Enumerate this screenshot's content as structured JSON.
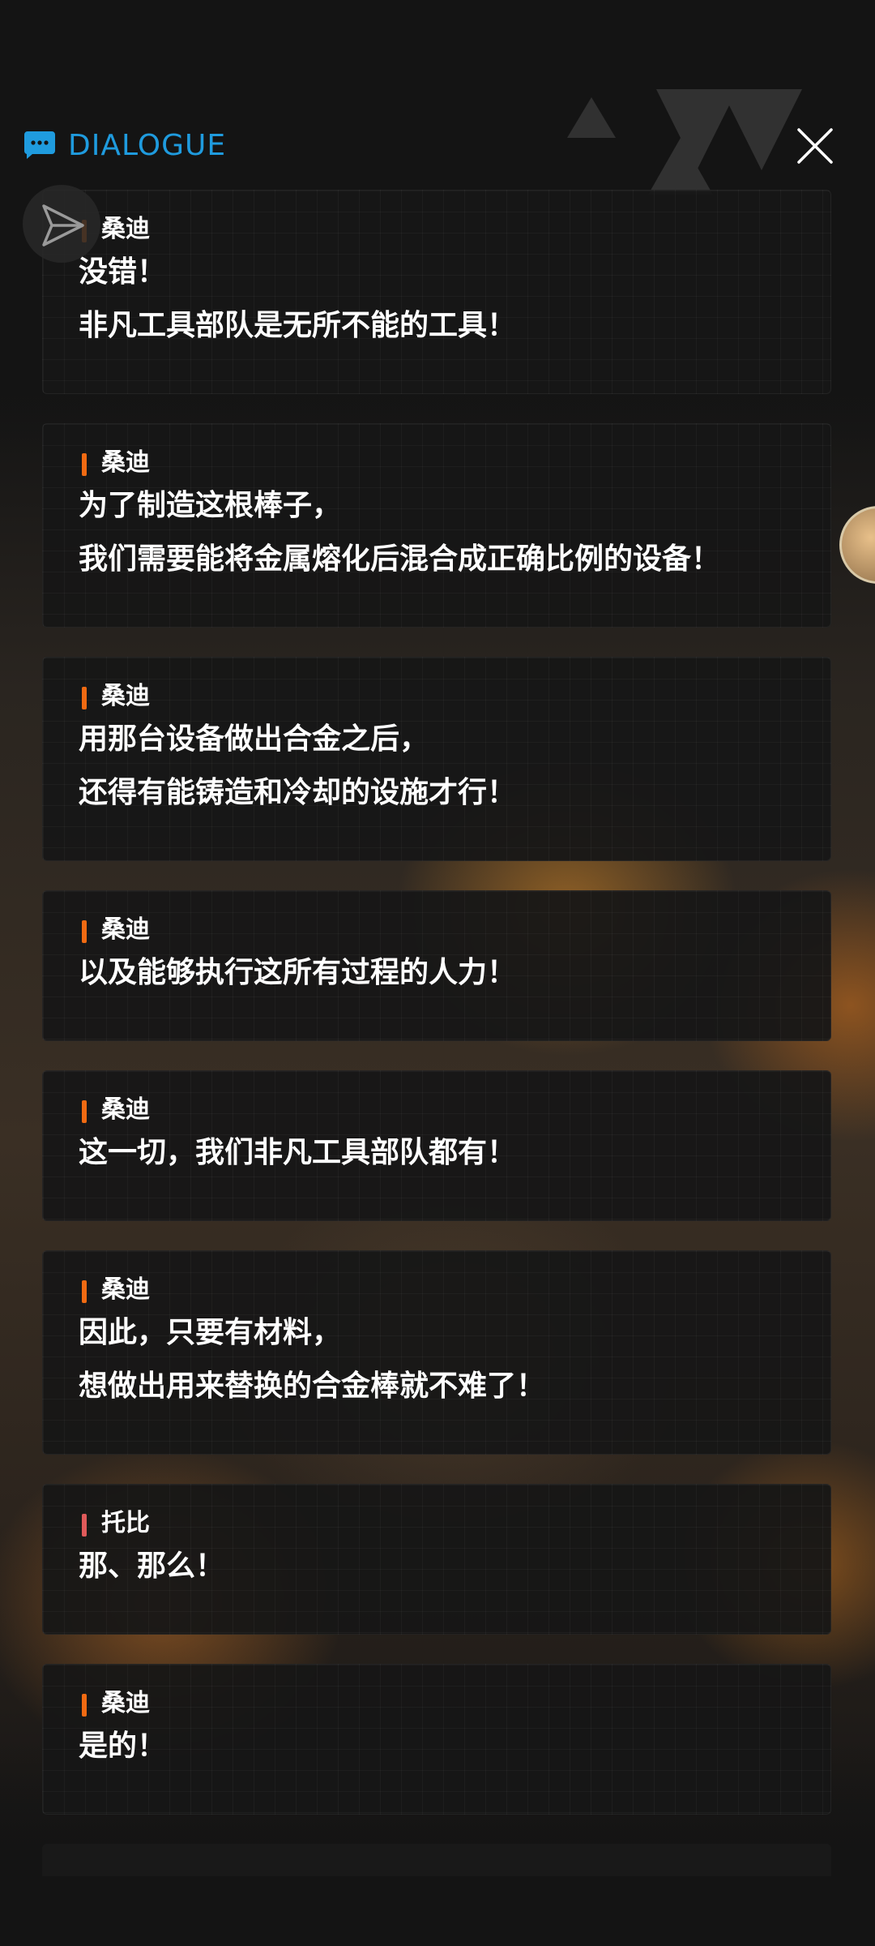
{
  "header": {
    "title": "DIALOGUE",
    "accent_color": "#1f9bde",
    "icon": "chat-bubble-icon",
    "close_icon": "close-icon",
    "share_icon": "send-icon"
  },
  "speaker_colors": {
    "桑迪": "#f06a12",
    "托比": "#e05a5a"
  },
  "dialogues": [
    {
      "speaker": "桑迪",
      "lines": [
        "没错！",
        "非凡工具部队是无所不能的工具！"
      ]
    },
    {
      "speaker": "桑迪",
      "lines": [
        "为了制造这根棒子，",
        "我们需要能将金属熔化后混合成正确比例的设备！"
      ]
    },
    {
      "speaker": "桑迪",
      "lines": [
        "用那台设备做出合金之后，",
        "还得有能铸造和冷却的设施才行！"
      ]
    },
    {
      "speaker": "桑迪",
      "lines": [
        "以及能够执行这所有过程的人力！"
      ]
    },
    {
      "speaker": "桑迪",
      "lines": [
        "这一切，我们非凡工具部队都有！"
      ]
    },
    {
      "speaker": "桑迪",
      "lines": [
        "因此，只要有材料，",
        "想做出用来替换的合金棒就不难了！"
      ]
    },
    {
      "speaker": "托比",
      "lines": [
        "那、那么！"
      ]
    },
    {
      "speaker": "桑迪",
      "lines": [
        "是的！"
      ]
    }
  ]
}
